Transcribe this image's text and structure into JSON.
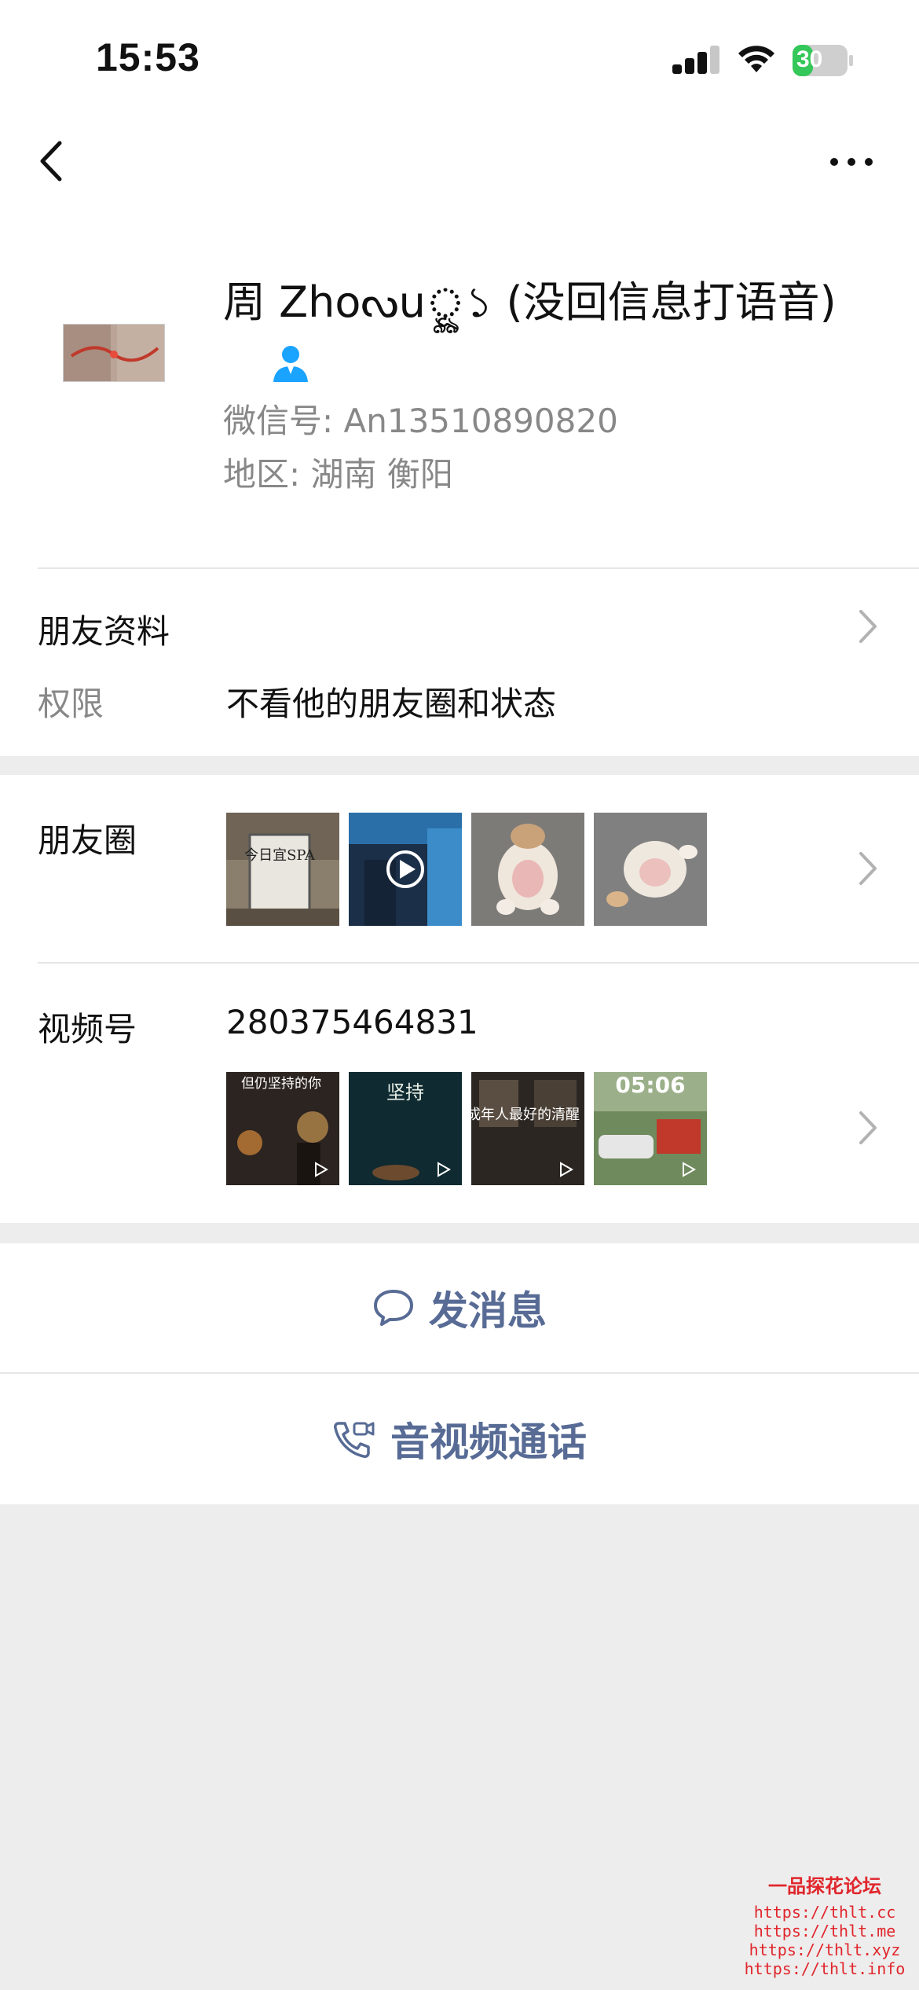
{
  "status_bar": {
    "time": "15:53",
    "battery": "30"
  },
  "profile": {
    "display_name": "周 Zhoᔓuৣূ১ (没回信息打语音)",
    "wechat_id": "微信号: An13510890820",
    "region": "地区: 湖南 衡阳"
  },
  "friend_info": {
    "label": "朋友资料",
    "permission_label": "权限",
    "permission_value": "不看他的朋友圈和状态"
  },
  "moments": {
    "label": "朋友圈",
    "thumbs": [
      {
        "caption": "今日宜SPA"
      },
      {
        "caption": ""
      },
      {
        "caption": ""
      },
      {
        "caption": ""
      }
    ]
  },
  "channels": {
    "label": "视频号",
    "id": "280375464831",
    "thumbs": [
      {
        "caption": "但仍坚持的你"
      },
      {
        "caption": "坚持"
      },
      {
        "caption": "成年人最好的清醒"
      },
      {
        "caption": "05:06"
      }
    ]
  },
  "actions": {
    "message": "发消息",
    "call": "音视频通话"
  },
  "watermark": {
    "title": "一品探花论坛",
    "urls": [
      "https://thlt.cc",
      "https://thlt.me",
      "https://thlt.xyz",
      "https://thlt.info"
    ]
  },
  "colors": {
    "link": "#576b95",
    "accent_blue": "#1aa3ff",
    "battery_green": "#34c759"
  }
}
